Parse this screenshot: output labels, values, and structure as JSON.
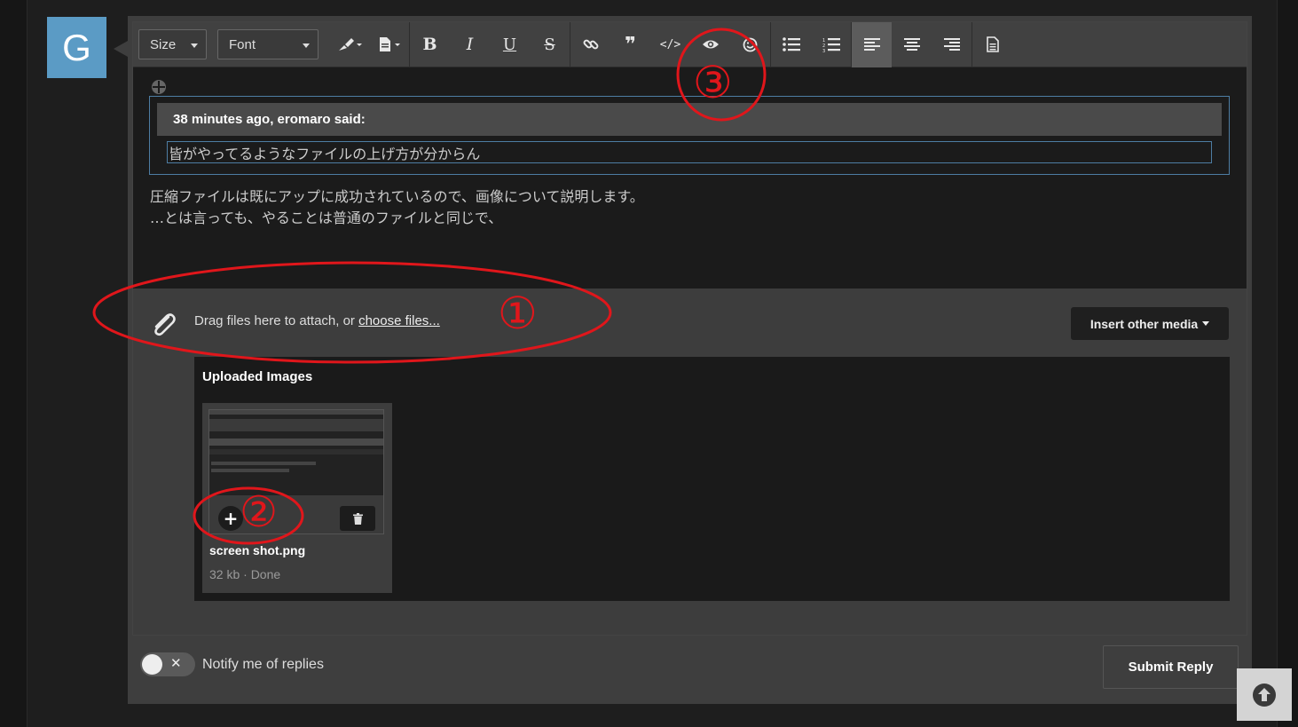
{
  "avatar": {
    "letter": "G",
    "color": "#5b9bc5"
  },
  "toolbar": {
    "size_label": "Size",
    "font_label": "Font",
    "buttons": [
      {
        "name": "color-icon"
      },
      {
        "name": "paragraph-icon"
      },
      {
        "name": "bold-icon"
      },
      {
        "name": "italic-icon"
      },
      {
        "name": "underline-icon"
      },
      {
        "name": "strikethrough-icon"
      },
      {
        "name": "link-icon"
      },
      {
        "name": "quote-icon"
      },
      {
        "name": "code-icon"
      },
      {
        "name": "preview-eye-icon"
      },
      {
        "name": "smiley-icon"
      },
      {
        "name": "bullet-list-icon"
      },
      {
        "name": "numbered-list-icon"
      },
      {
        "name": "align-left-icon"
      },
      {
        "name": "align-center-icon"
      },
      {
        "name": "align-right-icon"
      },
      {
        "name": "document-icon"
      }
    ]
  },
  "quote": {
    "header": "38 minutes ago, eromaro said:",
    "body": "皆がやってるようなファイルの上げ方が分からん"
  },
  "body_lines": [
    "圧縮ファイルは既にアップに成功されているので、画像について説明します。",
    "…とは言っても、やることは普通のファイルと同じで、"
  ],
  "attach": {
    "prompt": "Drag files here to attach, or ",
    "link": "choose files...",
    "insert_media": "Insert other media"
  },
  "uploaded": {
    "title": "Uploaded Images",
    "file_name": "screen shot.png",
    "file_meta": "32 kb · Done"
  },
  "notify": {
    "label": "Notify me of replies"
  },
  "submit": {
    "label": "Submit Reply"
  },
  "annotations": {
    "one": "①",
    "two": "②",
    "three": "③",
    "color": "#e0161b"
  }
}
